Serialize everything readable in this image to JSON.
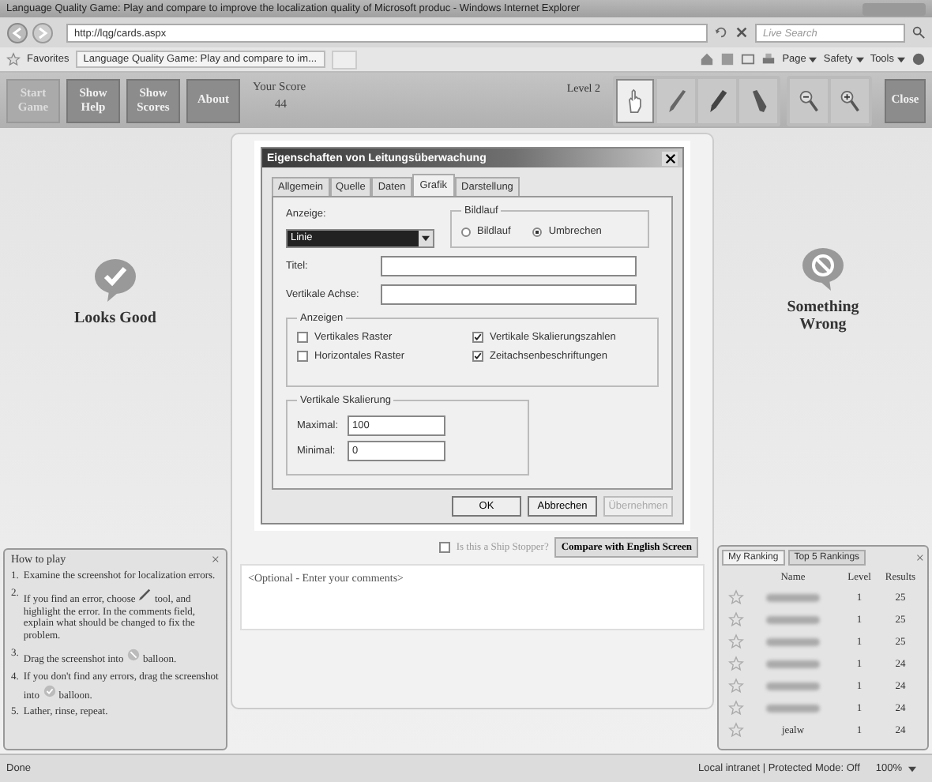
{
  "browser": {
    "title": "Language Quality Game: Play and compare to improve the localization quality of Microsoft produc - Windows Internet Explorer",
    "address": "http://lqg/cards.aspx",
    "search_placeholder": "Live Search",
    "favorites": "Favorites",
    "tab": "Language Quality Game: Play and compare to im...",
    "menus": [
      "Page",
      "Safety",
      "Tools"
    ]
  },
  "game_toolbar": {
    "buttons": [
      {
        "label": "Start Game",
        "disabled": true
      },
      {
        "label": "Show Help",
        "disabled": false
      },
      {
        "label": "Show Scores",
        "disabled": false
      },
      {
        "label": "About",
        "disabled": false
      }
    ],
    "score_label": "Your Score",
    "score": "44",
    "level": "Level 2",
    "tools": [
      {
        "kind": "hand",
        "selected": true
      },
      {
        "kind": "pencil",
        "selected": false
      },
      {
        "kind": "pen",
        "selected": false
      },
      {
        "kind": "marker",
        "selected": false
      }
    ],
    "zoom": [
      {
        "kind": "zoom-out"
      },
      {
        "kind": "zoom-in"
      }
    ],
    "close": "Close"
  },
  "balloons": [
    {
      "kind": "good",
      "label": "Looks Good"
    },
    {
      "kind": "wrong",
      "label": "Something Wrong"
    }
  ],
  "dialog": {
    "title": "Eigenschaften von Leitungsüberwachung",
    "tabs": [
      {
        "label": "Allgemein",
        "selected": false
      },
      {
        "label": "Quelle",
        "selected": false
      },
      {
        "label": "Daten",
        "selected": false
      },
      {
        "label": "Grafik",
        "selected": true
      },
      {
        "label": "Darstellung",
        "selected": false
      }
    ],
    "display_label": "Anzeige:",
    "display_value": "Linie",
    "scroll_group": "Bildlauf",
    "scroll_options": [
      {
        "label": "Bildlauf",
        "selected": false
      },
      {
        "label": "Umbrechen",
        "selected": true
      }
    ],
    "title_label": "Titel:",
    "axis_label": "Vertikale Achse:",
    "show_group": "Anzeigen",
    "show_options": [
      {
        "label": "Vertikales Raster",
        "checked": false
      },
      {
        "label": "Vertikale Skalierungszahlen",
        "checked": true
      },
      {
        "label": "Horizontales Raster",
        "checked": false
      },
      {
        "label": "Zeitachsenbeschriftungen",
        "checked": true
      }
    ],
    "scale_group": "Vertikale Skalierung",
    "max_label": "Maximal:",
    "max_value": "100",
    "min_label": "Minimal:",
    "min_value": "0",
    "buttons": [
      {
        "label": "OK",
        "disabled": false
      },
      {
        "label": "Abbrechen",
        "disabled": false
      },
      {
        "label": "Übernehmen",
        "disabled": true
      }
    ]
  },
  "ship_stopper": {
    "label": "Is this a Ship Stopper?",
    "checked": false
  },
  "compare_button": "Compare with English Screen",
  "comments": {
    "placeholder": "<Optional - Enter your comments>"
  },
  "help": {
    "title": "How to play",
    "close": "×",
    "steps": [
      {
        "number": "1.",
        "kind": "plain",
        "text": "Examine the screenshot for localization errors."
      },
      {
        "number": "2.",
        "text": "If you find an error, choose",
        "kind": "pencil",
        "rest": "tool, and highlight the error. In the comments field, explain what should be changed to fix the problem."
      },
      {
        "number": "3.",
        "text": "Drag the screenshot into",
        "kind": "wrong",
        "rest": "balloon."
      },
      {
        "number": "4.",
        "text": "If you don't find any errors, drag the screenshot into",
        "kind": "good",
        "rest": "balloon."
      },
      {
        "number": "5.",
        "kind": "plain",
        "text": "Lather, rinse, repeat."
      }
    ]
  },
  "ranking": {
    "tabs": [
      {
        "label": "My Ranking",
        "selected": true
      },
      {
        "label": "Top 5 Rankings",
        "selected": false
      }
    ],
    "close": "×",
    "columns": [
      "Name",
      "Level",
      "Results"
    ],
    "rows": [
      {
        "blurred": true,
        "level": "1",
        "result": "25"
      },
      {
        "blurred": true,
        "level": "1",
        "result": "25"
      },
      {
        "blurred": true,
        "level": "1",
        "result": "25"
      },
      {
        "blurred": true,
        "level": "1",
        "result": "24"
      },
      {
        "blurred": true,
        "level": "1",
        "result": "24"
      },
      {
        "blurred": true,
        "level": "1",
        "result": "24"
      },
      {
        "blurred": false,
        "name": "jealw",
        "level": "1",
        "result": "24"
      }
    ]
  },
  "status_bar": {
    "text": "Done",
    "zone": "Local intranet | Protected Mode: Off",
    "zoom": "100%"
  }
}
